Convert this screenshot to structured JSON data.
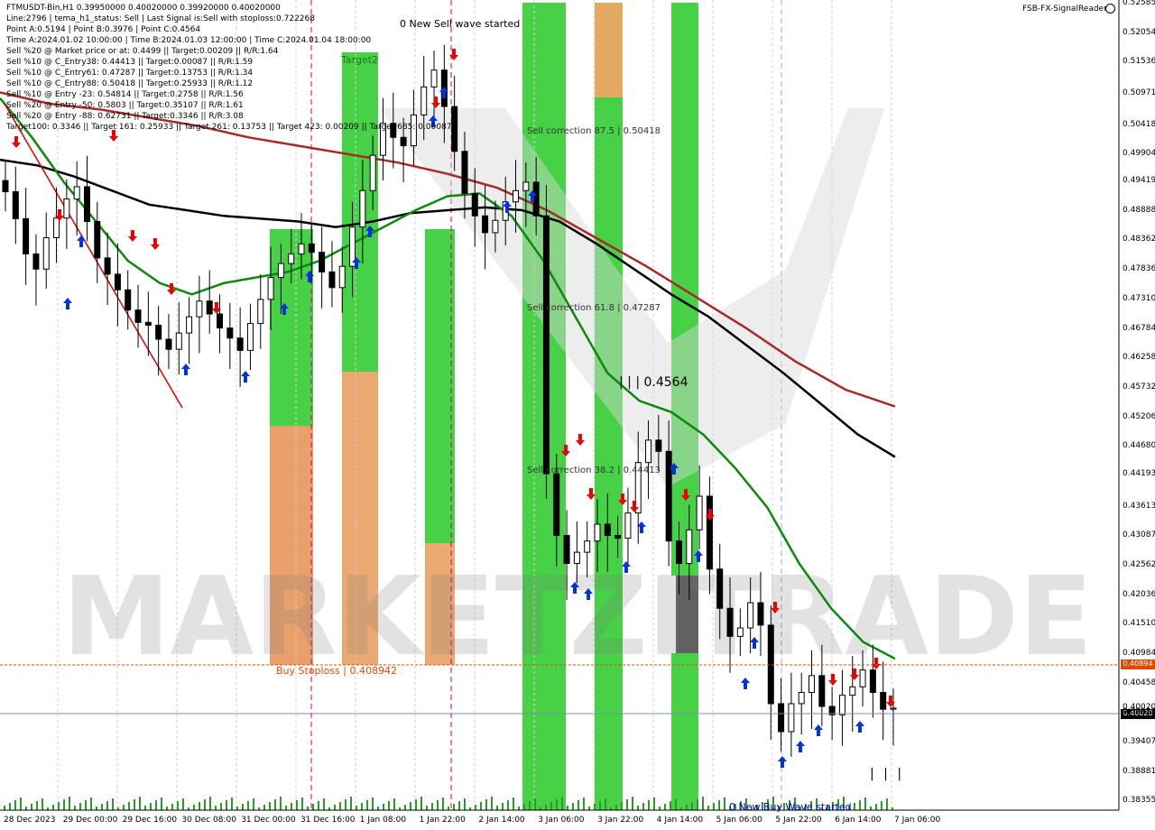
{
  "header": {
    "title_line": "FTMUSDT-Bin,H1  0.39950000 0.40020000 0.39920000 0.40020000",
    "lines": [
      "Line:2796 | tema_h1_status: Sell | Last Signal is:Sell with stoploss:0.722268",
      "Point A:0.5194 | Point B:0.3976 | Point C:0.4564",
      "Time A:2024.01.02 10:00:00 | Time B:2024.01.03 12:00:00 | Time C:2024.01.04 18:00:00",
      "Sell %20 @ Market price or at: 0.4499 || Target:0.00209 || R/R:1.64",
      "Sell %10 @ C_Entry38: 0.44413 || Target:0.00087 || R/R:1.59",
      "Sell %10 @ C_Entry61: 0.47287 || Target:0.13753 || R/R:1.34",
      "Sell %10 @ C_Entry88: 0.50418 || Target:0.25933 || R/R:1.12",
      "Sell %10 @ Entry -23: 0.54814 || Target:0.2758 || R/R:1.56",
      "Sell %20 @ Entry -50: 0.5803 || Target:0.35107 || R/R:1.61",
      "Sell %20 @ Entry -88: 0.62731 || Target:0.3346 || R/R:3.08",
      "Target100: 0.3346 || Target 161: 0.25933 || Target 261: 0.13753 || Target 423: 0.00209 || Target 685: 0.00087"
    ]
  },
  "brand_label": "FSB-FX-SignalReader",
  "watermark": "MARKETZITRADE",
  "annotations": {
    "sell_wave": "0 New Sell wave started",
    "buy_wave": "0 New Buy Wave started",
    "sell_corr_875": "Sell correction 87.5 | 0.50418",
    "sell_corr_618": "Sell correction 61.8 | 0.47287",
    "sell_corr_382": "Sell correction 38.2 | 0.44413",
    "point_c": "| | | 0.4564",
    "target2": "Target2",
    "buy_stoploss": "Buy Stoploss | 0.408942",
    "bottom_ticks": "| | |"
  },
  "chart_data": {
    "type": "candlestick",
    "symbol": "FTMUSDT-Bin",
    "timeframe": "H1",
    "last_price": 0.4002,
    "stoploss_line": 0.40894,
    "y_ticks": [
      0.52585,
      0.52054,
      0.51536,
      0.50971,
      0.50418,
      0.49904,
      0.49419,
      0.48888,
      0.48362,
      0.47836,
      0.4731,
      0.46784,
      0.46258,
      0.45732,
      0.45206,
      0.4468,
      0.44193,
      0.43613,
      0.43087,
      0.42562,
      0.42036,
      0.4151,
      0.40984,
      0.40458,
      0.39932,
      0.39407,
      0.38881,
      0.38355
    ],
    "y_tick_labels": [
      "0.52585",
      "0.52054",
      "0.51536",
      "0.50971",
      "0.50418",
      "0.49904",
      "0.49419",
      "0.48888",
      "0.48362",
      "0.47836",
      "0.47310",
      "0.46784",
      "0.46258",
      "0.45732",
      "0.45206",
      "0.44680",
      "0.44193",
      "0.43613",
      "0.43087",
      "0.42562",
      "0.42036",
      "0.41510",
      "0.40984",
      "0.40458",
      "0.40020",
      "0.39932",
      "0.39407",
      "0.38881",
      "0.38355"
    ],
    "price_tags": {
      "stoploss": "0.40894",
      "current": "0.40020"
    },
    "x_labels": [
      "28 Dec 2023",
      "29 Dec 00:00",
      "29 Dec 16:00",
      "30 Dec 08:00",
      "31 Dec 00:00",
      "31 Dec 16:00",
      "1 Jan 08:00",
      "1 Jan 22:00",
      "2 Jan 14:00",
      "3 Jan 06:00",
      "3 Jan 22:00",
      "4 Jan 14:00",
      "5 Jan 06:00",
      "5 Jan 22:00",
      "6 Jan 14:00",
      "7 Jan 06:00"
    ],
    "series": [
      {
        "name": "close",
        "color": "#000000",
        "values": [
          0.4923,
          0.4875,
          0.4812,
          0.4785,
          0.4841,
          0.4876,
          0.491,
          0.4932,
          0.487,
          0.4805,
          0.4776,
          0.4748,
          0.4712,
          0.469,
          0.4685,
          0.466,
          0.4642,
          0.4671,
          0.47,
          0.4728,
          0.4705,
          0.468,
          0.4662,
          0.464,
          0.4688,
          0.4731,
          0.477,
          0.4795,
          0.4812,
          0.483,
          0.4815,
          0.478,
          0.4752,
          0.479,
          0.486,
          0.4925,
          0.4988,
          0.5045,
          0.502,
          0.5005,
          0.506,
          0.511,
          0.514,
          0.5075,
          0.4995,
          0.492,
          0.488,
          0.485,
          0.4872,
          0.4905,
          0.4925,
          0.494,
          0.488,
          0.442,
          0.431,
          0.426,
          0.428,
          0.43,
          0.433,
          0.431,
          0.4305,
          0.435,
          0.444,
          0.448,
          0.446,
          0.43,
          0.426,
          0.432,
          0.438,
          0.425,
          0.418,
          0.413,
          0.4145,
          0.419,
          0.415,
          0.401,
          0.396,
          0.401,
          0.403,
          0.406,
          0.4005,
          0.399,
          0.4025,
          0.404,
          0.407,
          0.403,
          0.4,
          0.4002
        ]
      },
      {
        "name": "ema-green",
        "color": "#0a8a0a",
        "values": [
          0.509,
          0.502,
          0.494,
          0.487,
          0.48,
          0.476,
          0.474,
          0.476,
          0.477,
          0.478,
          0.48,
          0.483,
          0.486,
          0.489,
          0.4915,
          0.492,
          0.488,
          0.48,
          0.47,
          0.46,
          0.455,
          0.453,
          0.449,
          0.443,
          0.436,
          0.426,
          0.418,
          0.412,
          0.409
        ]
      },
      {
        "name": "ma-black",
        "color": "#000000",
        "values": [
          0.498,
          0.497,
          0.495,
          0.4925,
          0.49,
          0.489,
          0.488,
          0.4875,
          0.487,
          0.486,
          0.487,
          0.4885,
          0.489,
          0.4895,
          0.489,
          0.487,
          0.483,
          0.4785,
          0.474,
          0.47,
          0.465,
          0.46,
          0.4545,
          0.449,
          0.445
        ]
      },
      {
        "name": "ma-red",
        "color": "#a52a2a",
        "values": [
          0.51,
          0.508,
          0.507,
          0.5055,
          0.504,
          0.502,
          0.5005,
          0.499,
          0.4975,
          0.4955,
          0.493,
          0.489,
          0.484,
          0.479,
          0.4735,
          0.468,
          0.462,
          0.457,
          0.454
        ]
      }
    ]
  }
}
